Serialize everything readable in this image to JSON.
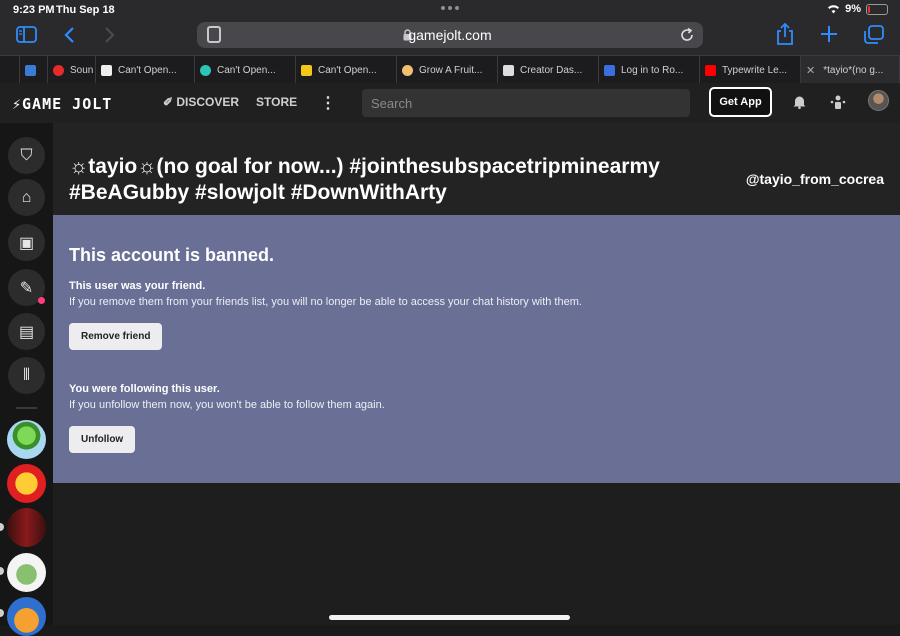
{
  "status_bar": {
    "time": "9:23 PM",
    "date": "Thu Sep 18",
    "battery": "9%"
  },
  "safari": {
    "url": "gamejolt.com",
    "tabs": [
      {
        "label": "",
        "favicon_color": "#3a7bd5"
      },
      {
        "label": "Soun",
        "favicon_color": "#e52b2b"
      },
      {
        "label": "Can't Open...",
        "favicon_color": "#eeeeee"
      },
      {
        "label": "Can't Open...",
        "favicon_color": "#2fc3b5"
      },
      {
        "label": "Can't Open...",
        "favicon_color": "#f5c518"
      },
      {
        "label": "Grow A Fruit...",
        "favicon_color": "#f0c070"
      },
      {
        "label": "Creator Das...",
        "favicon_color": "#dddddd"
      },
      {
        "label": "Log in to Ro...",
        "favicon_color": "#3b6fe0"
      },
      {
        "label": "Typewrite Le...",
        "favicon_color": "#ff0000"
      },
      {
        "label": "*tayio*(no g...",
        "favicon_color": "#cccccc"
      }
    ]
  },
  "gamejolt": {
    "logo": "GAME JOLT",
    "nav": {
      "discover": "DISCOVER",
      "store": "STORE"
    },
    "search_placeholder": "Search",
    "get_app": "Get App"
  },
  "profile": {
    "name": "☼tayio☼(no goal for now...) #jointhesubspacetripminearmy #BeAGubby #slowjolt #DownWithArty",
    "handle": "@tayio_from_cocrea"
  },
  "banned": {
    "title": "This account is banned.",
    "friend_heading": "This user was your friend.",
    "friend_text": "If you remove them from your friends list, you will no longer be able to access your chat history with them.",
    "remove_friend": "Remove friend",
    "follow_heading": "You were following this user.",
    "follow_text": "If you unfollow them now, you won't be able to follow them again.",
    "unfollow": "Unfollow"
  },
  "colors": {
    "banner": "#6a7095",
    "safari_accent": "#2f8cff",
    "notification": "#ff3f7a"
  }
}
